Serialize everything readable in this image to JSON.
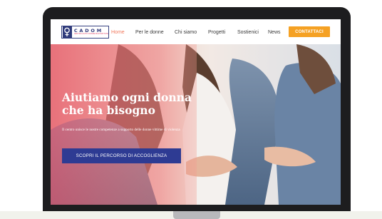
{
  "brand": {
    "name": "CADOM",
    "tagline": "CENTRO AIUTO DONNE MALTRATTATE",
    "colors": {
      "navy": "#2e3b93",
      "coral": "#f27a5e",
      "orange": "#f5a123",
      "pink": "#e24b6b"
    }
  },
  "nav": {
    "items": [
      {
        "label": "Home",
        "active": true
      },
      {
        "label": "Per le donne",
        "active": false
      },
      {
        "label": "Chi siamo",
        "active": false
      },
      {
        "label": "Progetti",
        "active": false
      },
      {
        "label": "Sostienici",
        "active": false
      },
      {
        "label": "News",
        "active": false
      }
    ],
    "cta_label": "CONTATTACI"
  },
  "hero": {
    "title_line1": "Aiutiamo ogni donna",
    "title_line2": "che ha bisogno",
    "text": "Il centro unisce le nostre competenze a supporto delle donne vittime di violenza",
    "button_label": "SCOPRI IL PERCORSO DI ACCOGLIENZA"
  },
  "icons": {
    "logo_mark": "female-symbol-icon"
  }
}
